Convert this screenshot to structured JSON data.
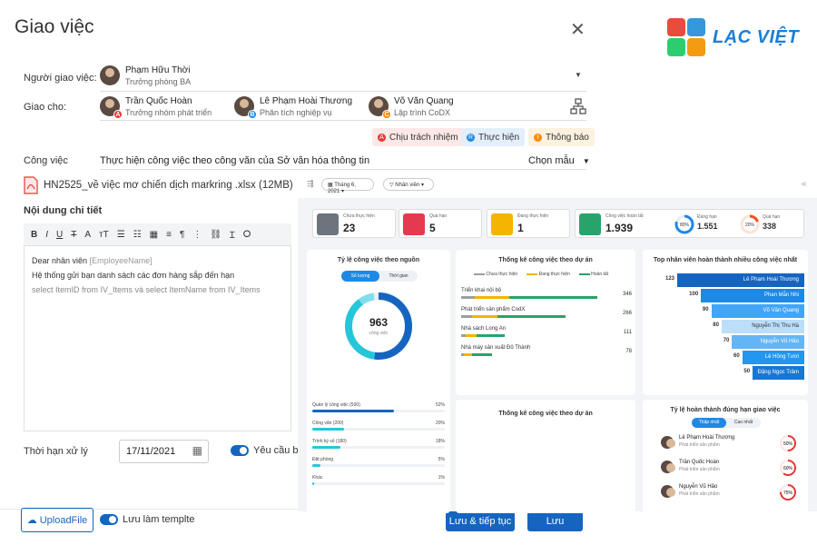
{
  "dialog": {
    "title": "Giao việc"
  },
  "brand": {
    "name": "LẠC VIỆT",
    "colors": [
      "#e74c3c",
      "#3498db",
      "#2ecc71",
      "#f39c12"
    ]
  },
  "assigner": {
    "label": "Người giao việc:",
    "name": "Phạm Hữu Thời",
    "role": "Trưởng phòng BA"
  },
  "assignees": {
    "label": "Giao cho:",
    "people": [
      {
        "name": "Trần Quốc Hoàn",
        "role": "Trưởng nhóm phát triển",
        "badge": "A",
        "badge_color": "#e53935"
      },
      {
        "name": "Lê Phạm Hoài Thương",
        "role": "Phân tích nghiệp vụ",
        "badge": "B",
        "badge_color": "#1e88e5"
      },
      {
        "name": "Võ Văn Quang",
        "role": "Lập trình CoDX",
        "badge": "C",
        "badge_color": "#fb8c00"
      }
    ]
  },
  "roles": [
    {
      "label": "Chịu trách nhiệm",
      "bg": "#fde8e8",
      "dot": "#e53935",
      "letter": "A"
    },
    {
      "label": "Thực hiện",
      "bg": "#e3effd",
      "dot": "#1e88e5",
      "letter": "R"
    },
    {
      "label": "Thông báo",
      "bg": "#fdf1e0",
      "dot": "#fb8c00",
      "letter": "I"
    }
  ],
  "task": {
    "label": "Công việc",
    "value": "Thực hiện công việc theo công văn của Sở văn hóa thông tin",
    "template_label": "Chọn mẫu"
  },
  "attachment": {
    "name": "HN2525_về việc mơ chiến dịch markring .xlsx (12MB)"
  },
  "detail": {
    "label": "Nội dung chi tiết",
    "line1": "Dear nhân viên",
    "placeholder": "[EmployeeName]",
    "line2": "Hệ thống gửi bạn danh sách các đơn hàng sắp đến hạn",
    "line3": "select ItemID from IV_Items và select ItemName from IV_Items"
  },
  "deadline": {
    "label": "Thời hạn xử lý",
    "value": "17/11/2021",
    "require_label": "Yêu cầu b"
  },
  "footer": {
    "upload": "UploadFile",
    "save_template": "Lưu làm templte",
    "save_continue": "Lưu & tiếp tục",
    "save": "Lưu"
  },
  "dashboard": {
    "filter_month": "Tháng 6, 2021",
    "filter_staff": "Nhân viên",
    "stats": [
      {
        "label": "Chưa thực hiện",
        "value": "23",
        "color": "#6c757d"
      },
      {
        "label": "Quá hạn",
        "value": "5",
        "color": "#e53950"
      },
      {
        "label": "Đang thực hiện",
        "value": "1",
        "color": "#f5b400"
      },
      {
        "label": "Công việc hoàn tất",
        "value": "1.939",
        "color": "#27a36b"
      }
    ],
    "ontime": {
      "label": "Đúng hạn",
      "value": "1.551",
      "pct": "80%"
    },
    "late": {
      "label": "Quá hạn",
      "value": "338",
      "pct": "20%"
    },
    "source": {
      "title": "Tỷ lệ công việc theo nguồn",
      "tab1": "Số lượng",
      "tab2": "Thời gian",
      "total": "963",
      "unit": "công việc",
      "items": [
        {
          "label": "Quản lý công việc (500)",
          "pct": "52%",
          "v": 52
        },
        {
          "label": "Công văn (200)",
          "pct": "20%",
          "v": 20
        },
        {
          "label": "Trình ký số (180)",
          "pct": "18%",
          "v": 18
        },
        {
          "label": "Đặt phòng",
          "pct": "5%",
          "v": 5
        },
        {
          "label": "Khác",
          "pct": "1%",
          "v": 1
        }
      ]
    },
    "project": {
      "title": "Thống kê công việc theo dự án",
      "legend": [
        "Chưa thực hiện",
        "Đang thực hiện",
        "Hoàn tất"
      ],
      "items": [
        {
          "name": "Triển khai nội bộ",
          "value": "346"
        },
        {
          "name": "Phát triển sản phẩm CodX",
          "value": "266"
        },
        {
          "name": "Nhà sách Long An",
          "value": "111"
        },
        {
          "name": "Nhà máy sản xuất Đô Thành",
          "value": "78"
        }
      ]
    },
    "project2": {
      "title": "Thống kê công việc theo dự án"
    },
    "top": {
      "title": "Top nhân viên hoàn thành nhiều công việc nhất",
      "items": [
        {
          "value": "123",
          "name": "Lê Phạm Hoài Thương"
        },
        {
          "value": "100",
          "name": "Phan Mẫn Nhi"
        },
        {
          "value": "90",
          "name": "Võ Văn Quang"
        },
        {
          "value": "80",
          "name": "Nguyễn Thị Thu Hà"
        },
        {
          "value": "70",
          "name": "Nguyễn Vũ Hảo"
        },
        {
          "value": "60",
          "name": "Lê Hồng Tươi"
        },
        {
          "value": "50",
          "name": "Đặng Ngọc Trâm"
        }
      ]
    },
    "rate": {
      "title": "Tỷ lệ hoàn thành đúng hạn giao việc",
      "tab1": "Thấp nhất",
      "tab2": "Cao nhất",
      "items": [
        {
          "name": "Lê Phạm Hoài Thương",
          "role": "Phát triển sản phẩm",
          "pct": "50%"
        },
        {
          "name": "Trần Quốc Hoàn",
          "role": "Phát triển sản phẩm",
          "pct": "60%"
        },
        {
          "name": "Nguyễn Vũ Hảo",
          "role": "Phát triển sản phẩm",
          "pct": "75%"
        }
      ]
    }
  }
}
